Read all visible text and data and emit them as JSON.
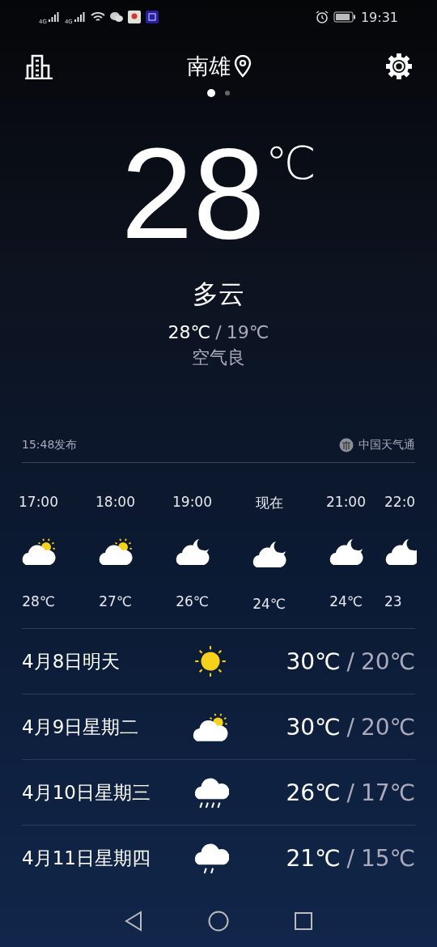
{
  "status_bar": {
    "networks": [
      "4G",
      "4G"
    ],
    "time": "19:31"
  },
  "header": {
    "city": "南雄"
  },
  "pages": [
    {
      "selected": true
    },
    {
      "selected": false
    }
  ],
  "current": {
    "temperature": "28",
    "unit": "℃",
    "condition": "多云",
    "high": "28℃",
    "separator": "/",
    "low": "19℃",
    "air_quality": "空气良"
  },
  "source": {
    "published": "15:48发布",
    "provider": "中国天气通"
  },
  "hourly": [
    {
      "time": "17:00",
      "kind": "partly-sunny",
      "temp": "28℃"
    },
    {
      "time": "18:00",
      "kind": "partly-sunny",
      "temp": "27℃"
    },
    {
      "time": "19:00",
      "kind": "partly-night",
      "temp": "26℃"
    },
    {
      "time": "现在",
      "kind": "partly-night",
      "temp": "24℃"
    },
    {
      "time": "21:00",
      "kind": "partly-night",
      "temp": "24℃"
    },
    {
      "time": "22:0",
      "kind": "partly-night",
      "temp": "23"
    }
  ],
  "daily": [
    {
      "date": "4月8日明天",
      "kind": "sunny",
      "high": "30℃",
      "separator": "/",
      "low": "20℃"
    },
    {
      "date": "4月9日星期二",
      "kind": "partly-sunny",
      "high": "30℃",
      "separator": "/",
      "low": "20℃"
    },
    {
      "date": "4月10日星期三",
      "kind": "rain-heavy",
      "high": "26℃",
      "separator": "/",
      "low": "17℃"
    },
    {
      "date": "4月11日星期四",
      "kind": "rain-light",
      "high": "21℃",
      "separator": "/",
      "low": "15℃"
    }
  ]
}
